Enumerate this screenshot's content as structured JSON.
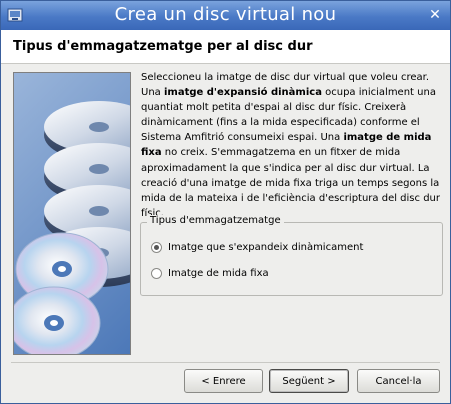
{
  "window": {
    "title": "Crea un disc virtual nou",
    "close_glyph": "✕"
  },
  "header": {
    "title": "Tipus d'emmagatzematge per al disc dur"
  },
  "description": {
    "p1": "Seleccioneu la imatge de disc dur virtual que voleu crear. Una ",
    "b1": "imatge d'expansió dinàmica",
    "p2": " ocupa inicialment una quantiat molt petita d'espai al disc dur físic. Creixerà dinàmicament (fins a la mida especificada) conforme el Sistema Amfitrió consumeixi espai. Una ",
    "b2": "imatge de mida fixa",
    "p3": " no creix. S'emmagatzema en un fitxer de mida aproximadament la que s'indica per al disc dur virtual. La creació d'una imatge de mida fixa triga un temps segons la mida de la mateixa i de l'eficiència d'escriptura del disc dur físic."
  },
  "storage_group": {
    "legend": "Tipus d'emmagatzematge",
    "options": [
      {
        "label": "Imatge que s'expandeix dinàmicament",
        "checked": true
      },
      {
        "label": "Imatge de mida fixa",
        "checked": false
      }
    ]
  },
  "buttons": {
    "back": "< Enrere",
    "next": "Següent >",
    "cancel": "Cancel·la"
  },
  "icons": {
    "app": "virtualbox-app-icon",
    "close": "close-icon",
    "illustration": "disks-stack-illustration"
  }
}
